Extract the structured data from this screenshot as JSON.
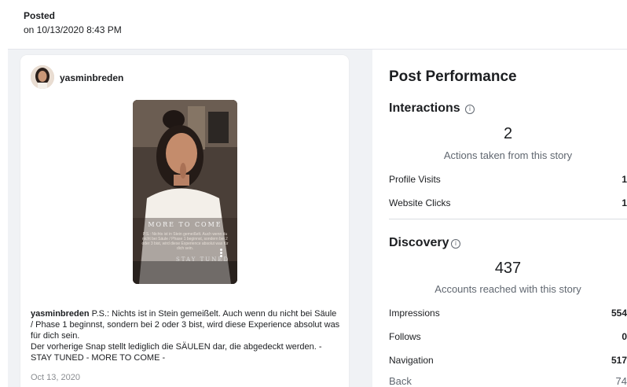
{
  "header": {
    "posted_label": "Posted",
    "posted_date": "on 10/13/2020 8:43 PM"
  },
  "post": {
    "username": "yasminbreden",
    "story_overlay": {
      "line1": "MORE TO COME",
      "line2": "P.S.: Nichts ist in Stein gemeißelt. Auch wenn du nicht bei Säule / Phase 1 beginnst, sondern bei 2 oder 3 bist, wird diese Experience absolut was für dich sein.",
      "line3": "STAY TUNED"
    },
    "video_progress": 0.55,
    "caption_user": "yasminbreden",
    "caption_text": "P.S.: Nichts ist in Stein gemeißelt. Auch wenn du nicht bei Säule / Phase 1 beginnst, sondern bei 2 oder 3 bist, wird diese Experience absolut was für dich sein.",
    "caption_text2": "Der vorherige Snap stellt lediglich die SÄULEN dar, die abgedeckt werden. - STAY TUNED - MORE TO COME -",
    "date": "Oct 13, 2020"
  },
  "performance": {
    "title": "Post Performance",
    "interactions": {
      "title": "Interactions",
      "info_icon": "info-icon",
      "value": "2",
      "subtitle": "Actions taken from this story",
      "rows": [
        {
          "label": "Profile Visits",
          "value": "1"
        },
        {
          "label": "Website Clicks",
          "value": "1"
        }
      ]
    },
    "discovery": {
      "title": "Discovery",
      "info_icon": "info-icon",
      "value": "437",
      "subtitle": "Accounts reached with this story",
      "rows": [
        {
          "label": "Impressions",
          "value": "554"
        },
        {
          "label": "Follows",
          "value": "0"
        },
        {
          "label": "Navigation",
          "value": "517"
        },
        {
          "label": "Back",
          "value": "74"
        }
      ]
    }
  },
  "colors": {
    "background_panel": "#f0f2f5",
    "text_primary": "#1c1e21",
    "text_secondary": "#606770"
  }
}
